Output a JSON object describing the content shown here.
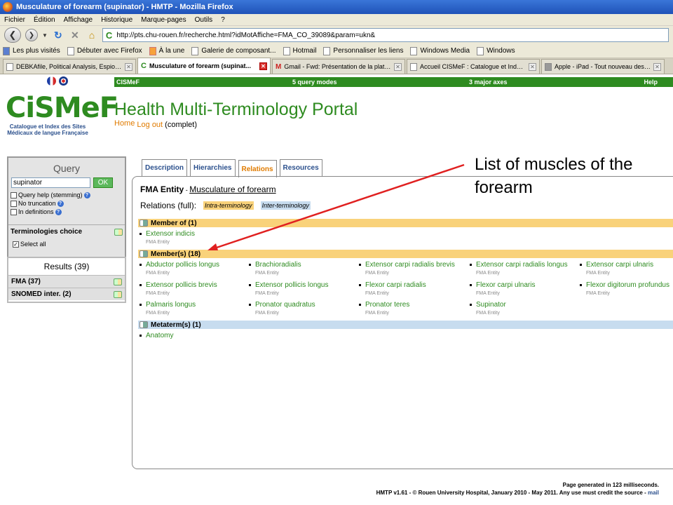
{
  "window": {
    "title": "Musculature of forearm (supinator) - HMTP - Mozilla Firefox"
  },
  "menu": [
    "Fichier",
    "Édition",
    "Affichage",
    "Historique",
    "Marque-pages",
    "Outils",
    "?"
  ],
  "nav": {
    "url": "http://pts.chu-rouen.fr/recherche.html?idMotAffiche=FMA_CO_39089&param=ukn&"
  },
  "bookmarks": [
    "Les plus visités",
    "Débuter avec Firefox",
    "À la une",
    "Galerie de composant...",
    "Hotmail",
    "Personnaliser les liens",
    "Windows Media",
    "Windows"
  ],
  "browser_tabs": [
    "DEBKAfile, Political Analysis, Espionage...",
    "Musculature of forearm (supinat...",
    "Gmail - Fwd: Présentation de la platefo...",
    "Accueil CISMeF : Catalogue et Index d...",
    "Apple - iPad - Tout nouveau design. Ap..."
  ],
  "site": {
    "topbar": {
      "brand": "CISMeF",
      "modes": "5 query modes",
      "axes": "3 major axes",
      "help": "Help"
    },
    "logo": {
      "word": "CiSMeF",
      "sub": "Catalogue et Index des Sites Médicaux de langue Française"
    },
    "title": "Health Multi-Terminology Portal",
    "home": "Home",
    "logout": "Log out",
    "mode": "(complet)"
  },
  "sidebar": {
    "query_title": "Query",
    "query_value": "supinator",
    "ok": "OK",
    "opt_help": "Query help (stemming)",
    "opt_trunc": "No truncation",
    "opt_def": "In definitions",
    "term_choice": "Terminologies choice",
    "select_all": "Select all",
    "results_title": "Results (39)",
    "results": [
      {
        "label": "FMA (37)"
      },
      {
        "label": "SNOMED inter. (2)"
      }
    ]
  },
  "content_tabs": [
    "Description",
    "Hierarchies",
    "Relations",
    "Resources"
  ],
  "entity": {
    "type": "FMA Entity",
    "sep": " - ",
    "name": "Musculature of forearm"
  },
  "relations": {
    "label": "Relations (full):",
    "intra": "Intra-terminology",
    "inter": "Inter-terminology"
  },
  "sections": {
    "member_of": {
      "title": "Member of (1)",
      "items": [
        {
          "name": "Extensor indicis",
          "type": "FMA Entity"
        }
      ]
    },
    "members": {
      "title": "Member(s) (18)",
      "items": [
        {
          "name": "Abductor pollicis longus",
          "type": "FMA Entity"
        },
        {
          "name": "Brachioradialis",
          "type": "FMA Entity"
        },
        {
          "name": "Extensor carpi radialis brevis",
          "type": "FMA Entity"
        },
        {
          "name": "Extensor carpi radialis longus",
          "type": "FMA Entity"
        },
        {
          "name": "Extensor carpi ulnaris",
          "type": "FMA Entity"
        },
        {
          "name": "Extensor pollicis brevis",
          "type": "FMA Entity"
        },
        {
          "name": "Extensor pollicis longus",
          "type": "FMA Entity"
        },
        {
          "name": "Flexor carpi radialis",
          "type": "FMA Entity"
        },
        {
          "name": "Flexor carpi ulnaris",
          "type": "FMA Entity"
        },
        {
          "name": "Flexor digitorum profundus",
          "type": "FMA Entity"
        },
        {
          "name": "Palmaris longus",
          "type": "FMA Entity"
        },
        {
          "name": "Pronator quadratus",
          "type": "FMA Entity"
        },
        {
          "name": "Pronator teres",
          "type": "FMA Entity"
        },
        {
          "name": "Supinator",
          "type": "FMA Entity"
        }
      ]
    },
    "metaterm": {
      "title": "Metaterm(s) (1)",
      "items": [
        {
          "name": "Anatomy"
        }
      ]
    }
  },
  "annotation": "List of muscles of the forearm",
  "footer": {
    "generated": "Page generated in 123 milliseconds.",
    "credit": "HMTP v1.61 - © Rouen University Hospital, January 2010 - May 2011. Any use must credit the source -",
    "mail": "mail"
  },
  "colors": {
    "brand_green": "#2e8b20",
    "accent_orange": "#e07b00",
    "member_bar": "#f9d27a",
    "metaterm_bar": "#c7dcef",
    "arrow_red": "#e02020"
  }
}
